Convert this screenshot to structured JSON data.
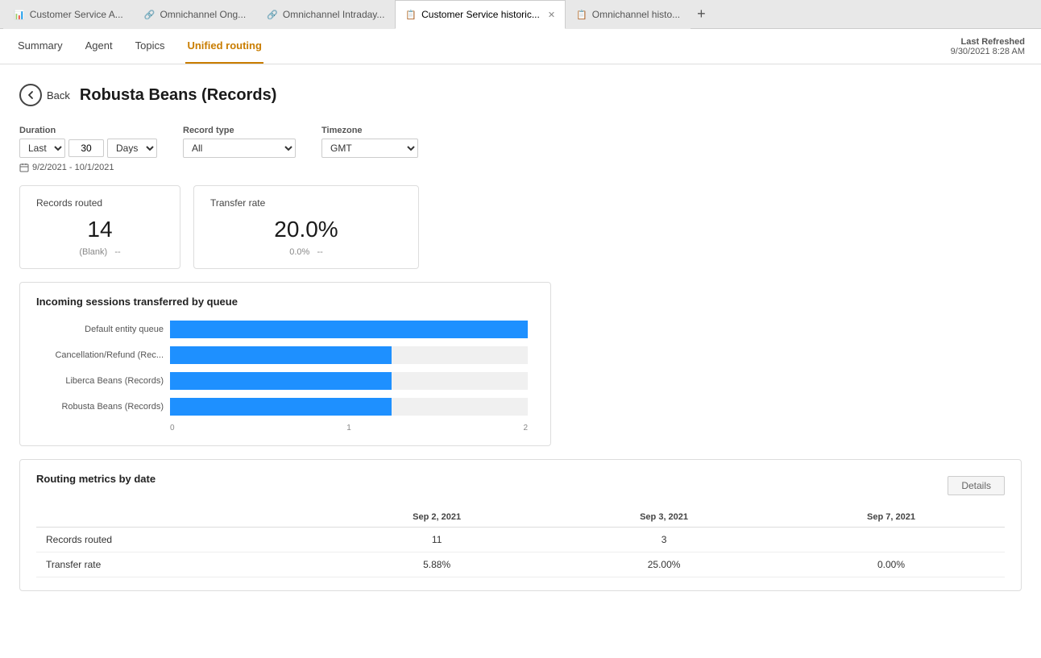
{
  "tabs": [
    {
      "id": "tab1",
      "icon": "📊",
      "label": "Customer Service A...",
      "active": false
    },
    {
      "id": "tab2",
      "icon": "🔗",
      "label": "Omnichannel Ong...",
      "active": false
    },
    {
      "id": "tab3",
      "icon": "🔗",
      "label": "Omnichannel Intraday...",
      "active": false
    },
    {
      "id": "tab4",
      "icon": "📋",
      "label": "Customer Service historic...",
      "active": true,
      "closable": true
    },
    {
      "id": "tab5",
      "icon": "📋",
      "label": "Omnichannel histo...",
      "active": false
    }
  ],
  "nav": {
    "tabs": [
      {
        "id": "summary",
        "label": "Summary",
        "active": false
      },
      {
        "id": "agent",
        "label": "Agent",
        "active": false
      },
      {
        "id": "topics",
        "label": "Topics",
        "active": false
      },
      {
        "id": "unified-routing",
        "label": "Unified routing",
        "active": true
      }
    ],
    "last_refreshed_label": "Last Refreshed",
    "last_refreshed_value": "9/30/2021 8:28 AM"
  },
  "page": {
    "back_label": "Back",
    "title": "Robusta Beans (Records)"
  },
  "filters": {
    "duration_label": "Duration",
    "duration_preset": "Last",
    "duration_number": "30",
    "duration_unit": "Days",
    "record_type_label": "Record type",
    "record_type_value": "All",
    "timezone_label": "Timezone",
    "timezone_value": "GMT",
    "date_range": "9/2/2021 - 10/1/2021"
  },
  "metric_cards": [
    {
      "title": "Records routed",
      "value": "14",
      "sub_left": "(Blank)",
      "sub_right": "--"
    },
    {
      "title": "Transfer rate",
      "value": "20.0%",
      "sub_left": "0.0%",
      "sub_right": "--"
    }
  ],
  "chart": {
    "title": "Incoming sessions transferred by queue",
    "bars": [
      {
        "label": "Default entity queue",
        "width_pct": 100
      },
      {
        "label": "Cancellation/Refund (Rec...",
        "width_pct": 62
      },
      {
        "label": "Liberca Beans (Records)",
        "width_pct": 62
      },
      {
        "label": "Robusta Beans (Records)",
        "width_pct": 62
      }
    ],
    "axis_labels": [
      "0",
      "1",
      "2"
    ]
  },
  "routing_table": {
    "title": "Routing metrics by date",
    "details_label": "Details",
    "columns": [
      "",
      "Sep 2, 2021",
      "Sep 3, 2021",
      "Sep 7, 2021"
    ],
    "rows": [
      {
        "metric": "Records routed",
        "values": [
          "11",
          "3",
          ""
        ]
      },
      {
        "metric": "Transfer rate",
        "values": [
          "5.88%",
          "25.00%",
          "0.00%"
        ]
      }
    ]
  }
}
